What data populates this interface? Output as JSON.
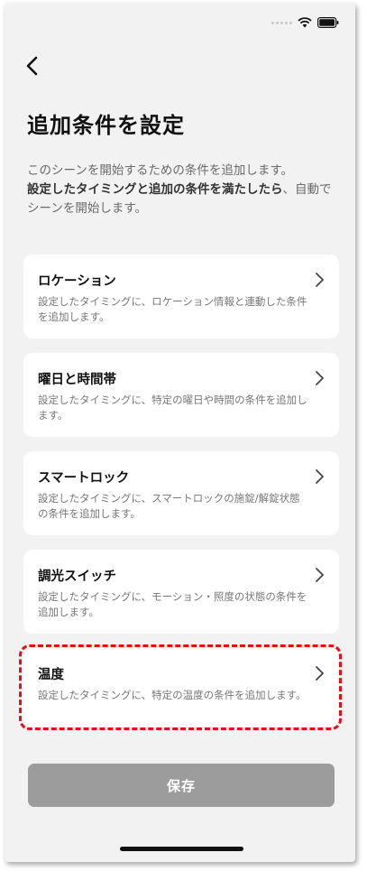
{
  "header": {
    "title": "追加条件を設定",
    "back_icon": "chevron-left-icon"
  },
  "description": {
    "line1": "このシーンを開始するための条件を追加します。",
    "bold": "設定したタイミングと追加の条件を満たしたら",
    "tail": "、自動でシーンを開始します。"
  },
  "cards": [
    {
      "title": "ロケーション",
      "desc": "設定したタイミングに、ロケーション情報と連動した条件を追加します。"
    },
    {
      "title": "曜日と時間帯",
      "desc": "設定したタイミングに、特定の曜日や時間の条件を追加します。"
    },
    {
      "title": "スマートロック",
      "desc": "設定したタイミングに、スマートロックの施錠/解錠状態の条件を追加します。"
    },
    {
      "title": "調光スイッチ",
      "desc": "設定したタイミングに、モーション・照度の状態の条件を追加します。"
    },
    {
      "title": "温度",
      "desc": "設定したタイミングに、特定の温度の条件を追加します。"
    }
  ],
  "save_button": {
    "label": "保存"
  },
  "colors": {
    "background": "#f2f2f2",
    "card": "#ffffff",
    "highlight": "#e0101a",
    "save_button": "#9c9c9c"
  }
}
